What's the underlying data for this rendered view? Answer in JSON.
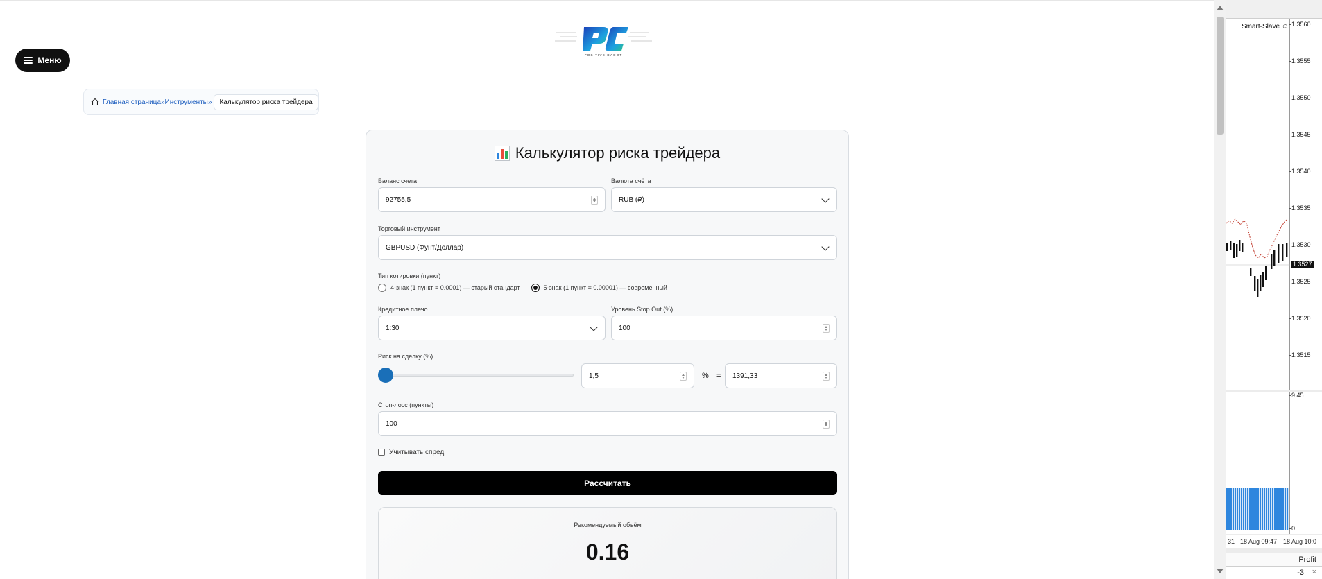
{
  "nav": {
    "menu_label": "Меню"
  },
  "logo": {
    "text": "POSITIVE DAOOT"
  },
  "breadcrumb": {
    "home": "Главная страница",
    "sep": " »",
    "section": "Инструменты",
    "sep2": "»",
    "current": "Калькулятор риска трейдера"
  },
  "calculator": {
    "title": "Калькулятор риска трейдера",
    "balance": {
      "label": "Баланс счета",
      "value": "92755,5"
    },
    "currency": {
      "label": "Валюта счёта",
      "value": "RUB (₽)"
    },
    "instrument": {
      "label": "Торговый инструмент",
      "value": "GBPUSD (Фунт/Доллар)"
    },
    "quote_type": {
      "label": "Тип котировки (пункт)",
      "options": [
        {
          "label": "4-знак (1 пункт = 0.0001) — старый стандарт",
          "selected": false
        },
        {
          "label": "5-знак (1 пункт = 0.00001) — современный",
          "selected": true
        }
      ]
    },
    "leverage": {
      "label": "Кредитное плечо",
      "value": "1:30"
    },
    "stop_out": {
      "label": "Уровень Stop Out (%)",
      "value": "100"
    },
    "risk": {
      "label": "Риск на сделку (%)",
      "slider_fraction": 0.0,
      "percent": "1,5",
      "percent_sign": "%",
      "equals": "=",
      "amount": "1391,33"
    },
    "stop_loss": {
      "label": "Стоп-лосс (пункты)",
      "value": "100"
    },
    "spread": {
      "label": "Учитывать спред",
      "checked": false
    },
    "calculate_label": "Рассчитать",
    "result": {
      "label": "Рекомендуемый объём",
      "value": "0.16"
    }
  },
  "terminal": {
    "ea_label": "Smart-Slave ☺",
    "price_ticks": [
      "1.3560",
      "1.3555",
      "1.3550",
      "1.3545",
      "1.3540",
      "1.3535",
      "1.3530",
      "1.3525",
      "1.3520",
      "1.3515"
    ],
    "current_price": "1.3527",
    "sub_ticks": [
      "9.45",
      "0"
    ],
    "time_labels": [
      "31",
      "18 Aug 09:47",
      "18 Aug 10:0"
    ],
    "profit_header": "Profit",
    "profit_value": "-3",
    "close": "×",
    "colors": {
      "bars": "#2e86de",
      "ma": "#c0392b"
    }
  }
}
